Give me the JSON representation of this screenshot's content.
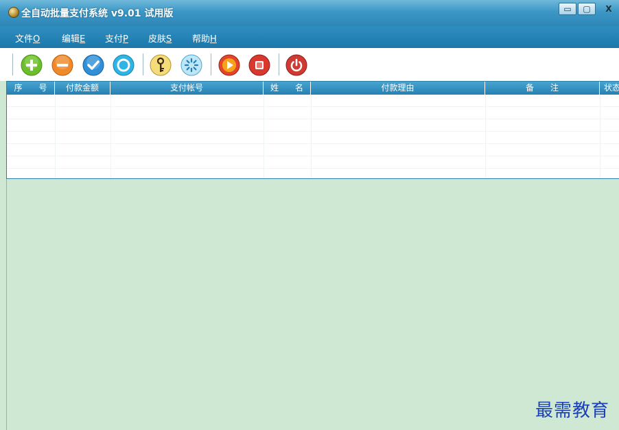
{
  "window": {
    "title": "全自动批量支付系统 v9.01 试用版",
    "controls": {
      "minimize": "▭",
      "maximize": "▢",
      "close": "X"
    }
  },
  "menu": {
    "items": [
      {
        "label": "文件",
        "accel": "O"
      },
      {
        "label": "编辑",
        "accel": "E"
      },
      {
        "label": "支付",
        "accel": "P"
      },
      {
        "label": "皮肤",
        "accel": "S"
      },
      {
        "label": "帮助",
        "accel": "H"
      }
    ]
  },
  "toolbar": {
    "buttons": [
      {
        "icon": "add-icon",
        "color": "#6cbf2a"
      },
      {
        "icon": "remove-icon",
        "color": "#f0892a"
      },
      {
        "icon": "check-icon",
        "color": "#2f8fd8"
      },
      {
        "icon": "ring-icon",
        "color": "#2fb4e6"
      },
      {
        "icon": "key-icon",
        "color": "#e9c24b"
      },
      {
        "icon": "refresh-icon",
        "color": "#7cc7ec"
      },
      {
        "icon": "play-icon",
        "color": "#e2452a"
      },
      {
        "icon": "stop-icon",
        "color": "#d9382f"
      },
      {
        "icon": "power-icon",
        "color": "#cf3b33"
      }
    ]
  },
  "table": {
    "columns": [
      "序　　号",
      "付款金额",
      "支付帐号",
      "姓　　名",
      "付款理由",
      "备　　注",
      "状态"
    ],
    "rows": []
  },
  "watermark": "最需教育"
}
